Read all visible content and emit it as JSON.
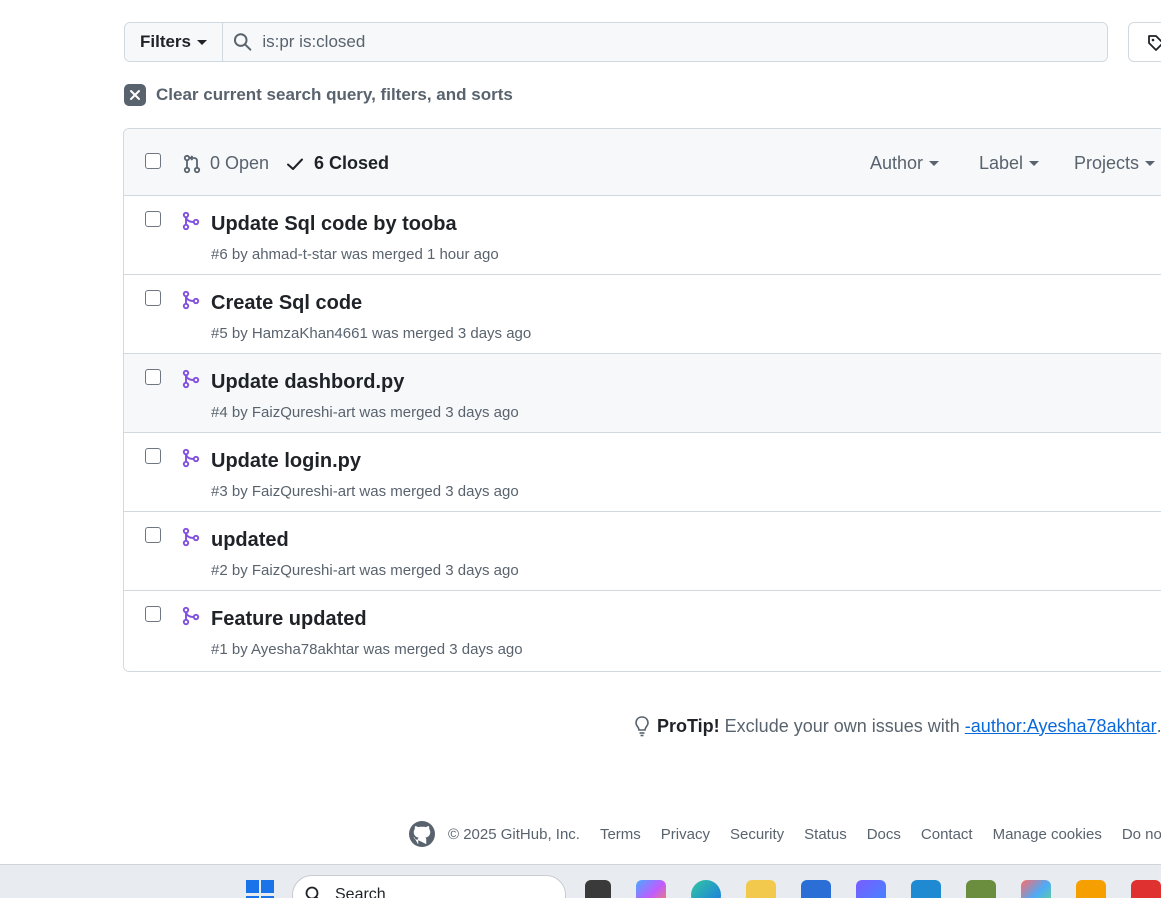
{
  "filters": {
    "label": "Filters",
    "query": "is:pr is:closed"
  },
  "clear": {
    "label": "Clear current search query, filters, and sorts"
  },
  "header": {
    "open_label": "0 Open",
    "closed_label": "6 Closed",
    "menus": [
      "Author",
      "Label",
      "Projects"
    ]
  },
  "pull_requests": [
    {
      "title": "Update Sql code by tooba",
      "number": "#6",
      "by": "by",
      "author": "ahmad-t-star",
      "status": "was merged 1 hour ago"
    },
    {
      "title": "Create Sql code",
      "number": "#5",
      "by": "by",
      "author": "HamzaKhan4661",
      "status": "was merged 3 days ago"
    },
    {
      "title": "Update dashbord.py",
      "number": "#4",
      "by": "by",
      "author": "FaizQureshi-art",
      "status": "was merged 3 days ago"
    },
    {
      "title": "Update login.py",
      "number": "#3",
      "by": "by",
      "author": "FaizQureshi-art",
      "status": "was merged 3 days ago"
    },
    {
      "title": "updated",
      "number": "#2",
      "by": "by",
      "author": "FaizQureshi-art",
      "status": "was merged 3 days ago"
    },
    {
      "title": "Feature updated",
      "number": "#1",
      "by": "by",
      "author": "Ayesha78akhtar",
      "status": "was merged 3 days ago"
    }
  ],
  "protip": {
    "label": "ProTip!",
    "text": "Exclude your own issues with",
    "link": "-author:Ayesha78akhtar",
    "end": "."
  },
  "footer": {
    "copyright": "© 2025 GitHub, Inc.",
    "links": [
      "Terms",
      "Privacy",
      "Security",
      "Status",
      "Docs",
      "Contact",
      "Manage cookies",
      "Do not s"
    ]
  },
  "taskbar": {
    "search_placeholder": "Search"
  },
  "colors": {
    "merged": "#8250df",
    "link": "#0969da",
    "muted": "#59636e",
    "accent_windows": "#1a73e8"
  }
}
